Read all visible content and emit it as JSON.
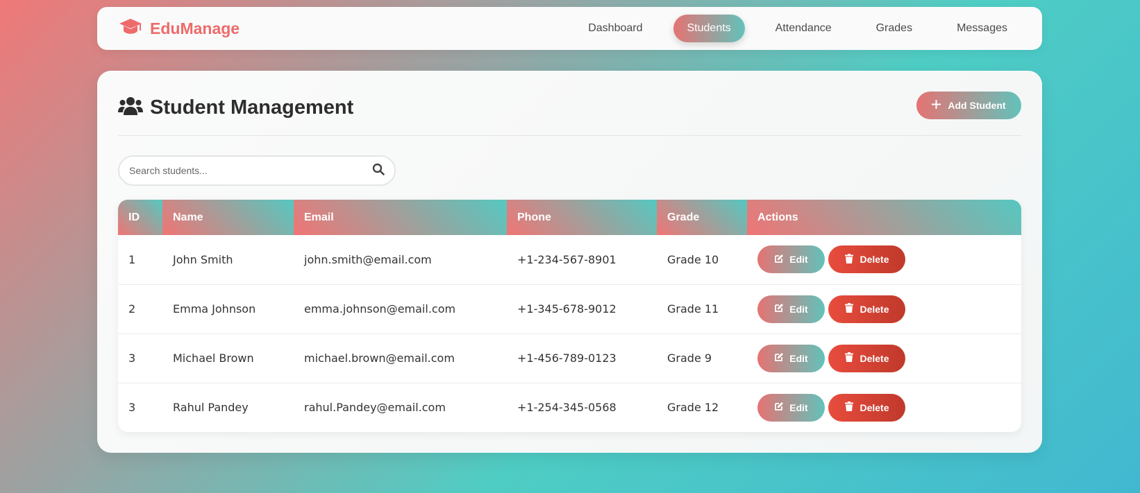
{
  "brand": {
    "name": "EduManage",
    "icon": "graduation-cap-icon"
  },
  "nav": {
    "items": [
      {
        "label": "Dashboard",
        "active": false
      },
      {
        "label": "Students",
        "active": true
      },
      {
        "label": "Attendance",
        "active": false
      },
      {
        "label": "Grades",
        "active": false
      },
      {
        "label": "Messages",
        "active": false
      }
    ]
  },
  "page": {
    "title": "Student Management",
    "title_icon": "users-icon",
    "add_button_label": "Add Student"
  },
  "search": {
    "placeholder": "Search students...",
    "value": ""
  },
  "table": {
    "columns": [
      "ID",
      "Name",
      "Email",
      "Phone",
      "Grade",
      "Actions"
    ],
    "rows": [
      {
        "id": "1",
        "name": "John Smith",
        "email": "john.smith@email.com",
        "phone": "+1-234-567-8901",
        "grade": "Grade 10"
      },
      {
        "id": "2",
        "name": "Emma Johnson",
        "email": "emma.johnson@email.com",
        "phone": "+1-345-678-9012",
        "grade": "Grade 11"
      },
      {
        "id": "3",
        "name": "Michael Brown",
        "email": "michael.brown@email.com",
        "phone": "+1-456-789-0123",
        "grade": "Grade 9"
      },
      {
        "id": "3",
        "name": "Rahul Pandey",
        "email": "rahul.Pandey@email.com",
        "phone": "+1-254-345-0568",
        "grade": "Grade 12"
      }
    ],
    "edit_label": "Edit",
    "delete_label": "Delete"
  },
  "colors": {
    "accent_coral": "#ee6b6b",
    "accent_teal": "#4ecdc4",
    "danger": "#e84c3d"
  }
}
